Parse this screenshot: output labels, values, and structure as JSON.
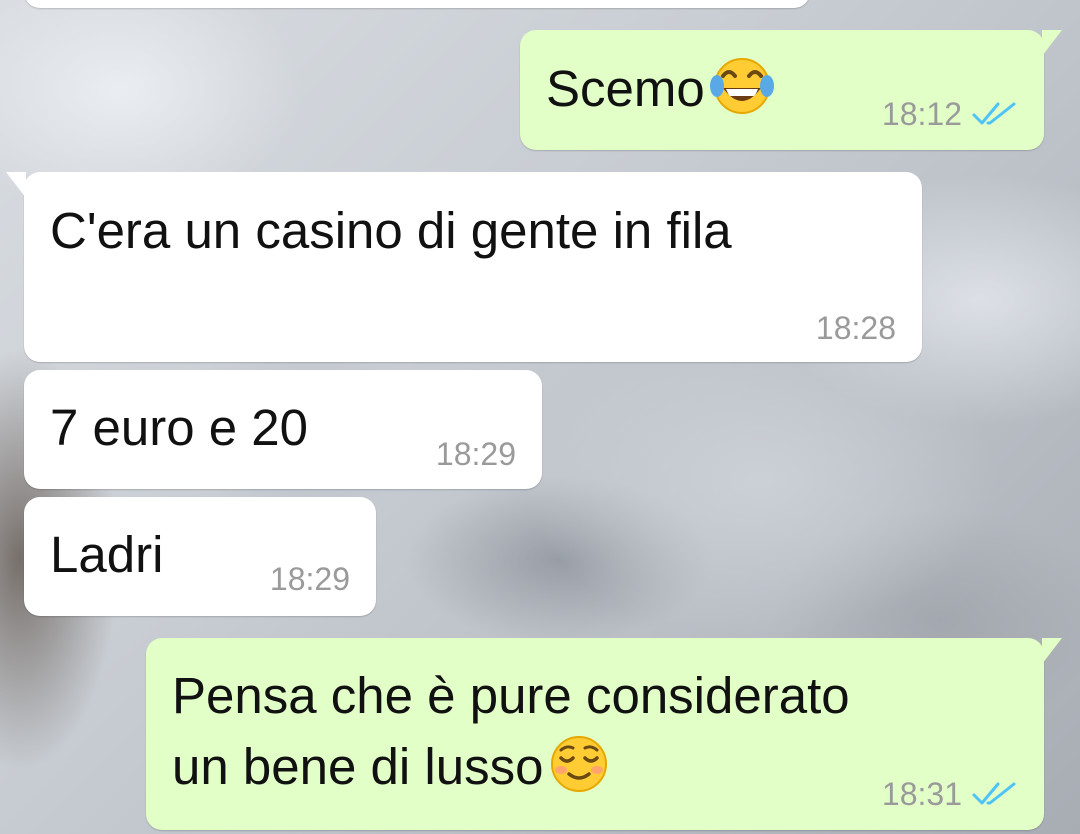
{
  "chat": {
    "messages": [
      {
        "direction": "out",
        "text": "Scemo",
        "emoji": "face-with-tears-of-joy",
        "time": "18:12",
        "status": "read"
      },
      {
        "direction": "in",
        "text": "C'era un casino di gente in fila",
        "time": "18:28"
      },
      {
        "direction": "in",
        "text": "7 euro e 20",
        "time": "18:29"
      },
      {
        "direction": "in",
        "text": "Ladri",
        "time": "18:29"
      },
      {
        "direction": "out",
        "text_line1": "Pensa che è pure considerato",
        "text_line2": "un bene di lusso",
        "emoji": "smiling-face",
        "time": "18:31",
        "status": "read"
      }
    ]
  },
  "colors": {
    "incoming_bubble": "#ffffff",
    "outgoing_bubble": "#e1ffc7",
    "read_ticks": "#4fc3f7",
    "timestamp": "#9a9a9a"
  }
}
